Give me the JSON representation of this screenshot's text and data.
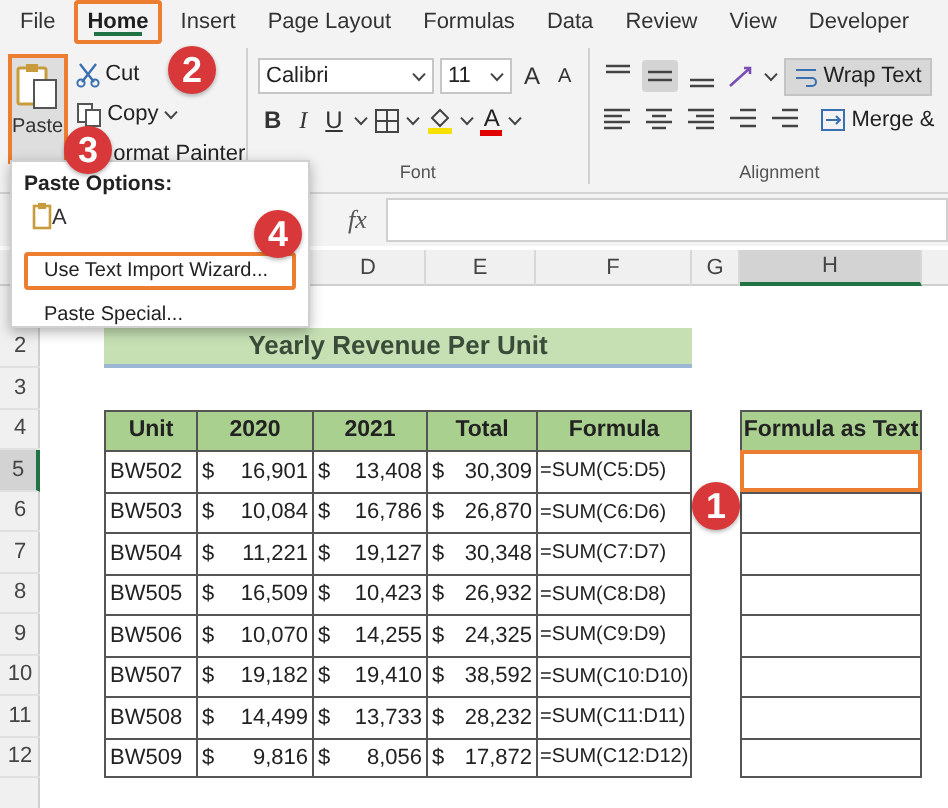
{
  "tabs": [
    {
      "label": "File",
      "selected": false,
      "highlighted": false
    },
    {
      "label": "Home",
      "selected": true,
      "highlighted": true
    },
    {
      "label": "Insert",
      "selected": false,
      "highlighted": false
    },
    {
      "label": "Page Layout",
      "selected": false,
      "highlighted": false
    },
    {
      "label": "Formulas",
      "selected": false,
      "highlighted": false
    },
    {
      "label": "Data",
      "selected": false,
      "highlighted": false
    },
    {
      "label": "Review",
      "selected": false,
      "highlighted": false
    },
    {
      "label": "View",
      "selected": false,
      "highlighted": false
    },
    {
      "label": "Developer",
      "selected": false,
      "highlighted": false
    }
  ],
  "clipboard": {
    "paste": {
      "label": "Paste",
      "highlighted": true
    },
    "cut": "Cut",
    "copy": "Copy",
    "format_painter": "ormat Painter"
  },
  "font": {
    "name": "Calibri",
    "size": "11",
    "grow": "A",
    "shrink": "A",
    "bold": "B",
    "italic": "I",
    "underline": "U",
    "color_letter": "A",
    "label": "Font"
  },
  "alignment": {
    "vertical": [
      {
        "selected": false
      },
      {
        "selected": true
      },
      {
        "selected": false
      }
    ],
    "wrap_text": {
      "label": "Wrap Text",
      "on": true
    },
    "merge": "Merge &",
    "label": "Alignment"
  },
  "paste_menu": {
    "title": "Paste Options:",
    "option_letter": "A",
    "items": [
      {
        "label": "Use Text Import Wizard...",
        "highlighted": true
      },
      {
        "label": "Paste Special...",
        "highlighted": false
      }
    ]
  },
  "formula_bar": {
    "function_label": "fx"
  },
  "sheet": {
    "columns": [
      {
        "label": "D",
        "selected": false
      },
      {
        "label": "E",
        "selected": false
      },
      {
        "label": "F",
        "selected": false
      },
      {
        "label": "G",
        "selected": false
      },
      {
        "label": "H",
        "selected": true
      }
    ],
    "row_headers": [
      {
        "label": "2",
        "selected": false
      },
      {
        "label": "3",
        "selected": false
      },
      {
        "label": "4",
        "selected": false
      },
      {
        "label": "5",
        "selected": true
      },
      {
        "label": "6",
        "selected": false
      },
      {
        "label": "7",
        "selected": false
      },
      {
        "label": "8",
        "selected": false
      },
      {
        "label": "9",
        "selected": false
      },
      {
        "label": "10",
        "selected": false
      },
      {
        "label": "11",
        "selected": false
      },
      {
        "label": "12",
        "selected": false
      }
    ],
    "title": "Yearly Revenue Per Unit",
    "table": {
      "columns": [
        "Unit",
        "2020",
        "2021",
        "Total",
        "Formula"
      ],
      "rows": [
        {
          "unit": "BW502",
          "amounts": [
            {
              "symbol": "$",
              "value": "16,901"
            },
            {
              "symbol": "$",
              "value": "13,408"
            },
            {
              "symbol": "$",
              "value": "30,309"
            }
          ],
          "formula": "=SUM(C5:D5)"
        },
        {
          "unit": "BW503",
          "amounts": [
            {
              "symbol": "$",
              "value": "10,084"
            },
            {
              "symbol": "$",
              "value": "16,786"
            },
            {
              "symbol": "$",
              "value": "26,870"
            }
          ],
          "formula": "=SUM(C6:D6)"
        },
        {
          "unit": "BW504",
          "amounts": [
            {
              "symbol": "$",
              "value": "11,221"
            },
            {
              "symbol": "$",
              "value": "19,127"
            },
            {
              "symbol": "$",
              "value": "30,348"
            }
          ],
          "formula": "=SUM(C7:D7)"
        },
        {
          "unit": "BW505",
          "amounts": [
            {
              "symbol": "$",
              "value": "16,509"
            },
            {
              "symbol": "$",
              "value": "10,423"
            },
            {
              "symbol": "$",
              "value": "26,932"
            }
          ],
          "formula": "=SUM(C8:D8)"
        },
        {
          "unit": "BW506",
          "amounts": [
            {
              "symbol": "$",
              "value": "10,070"
            },
            {
              "symbol": "$",
              "value": "14,255"
            },
            {
              "symbol": "$",
              "value": "24,325"
            }
          ],
          "formula": "=SUM(C9:D9)"
        },
        {
          "unit": "BW507",
          "amounts": [
            {
              "symbol": "$",
              "value": "19,182"
            },
            {
              "symbol": "$",
              "value": "19,410"
            },
            {
              "symbol": "$",
              "value": "38,592"
            }
          ],
          "formula": "=SUM(C10:D10)"
        },
        {
          "unit": "BW508",
          "amounts": [
            {
              "symbol": "$",
              "value": "14,499"
            },
            {
              "symbol": "$",
              "value": "13,733"
            },
            {
              "symbol": "$",
              "value": "28,232"
            }
          ],
          "formula": "=SUM(C11:D11)"
        },
        {
          "unit": "BW509",
          "amounts": [
            {
              "symbol": "$",
              "value": "9,816"
            },
            {
              "symbol": "$",
              "value": "8,056"
            },
            {
              "symbol": "$",
              "value": "17,872"
            }
          ],
          "formula": "=SUM(C12:D12)"
        }
      ]
    },
    "text_table": {
      "header": "Formula as Text",
      "cells": [
        {
          "selected": true
        },
        {
          "selected": false
        },
        {
          "selected": false
        },
        {
          "selected": false
        },
        {
          "selected": false
        },
        {
          "selected": false
        },
        {
          "selected": false
        },
        {
          "selected": false
        }
      ]
    }
  },
  "callouts": [
    "1",
    "2",
    "3",
    "4"
  ]
}
